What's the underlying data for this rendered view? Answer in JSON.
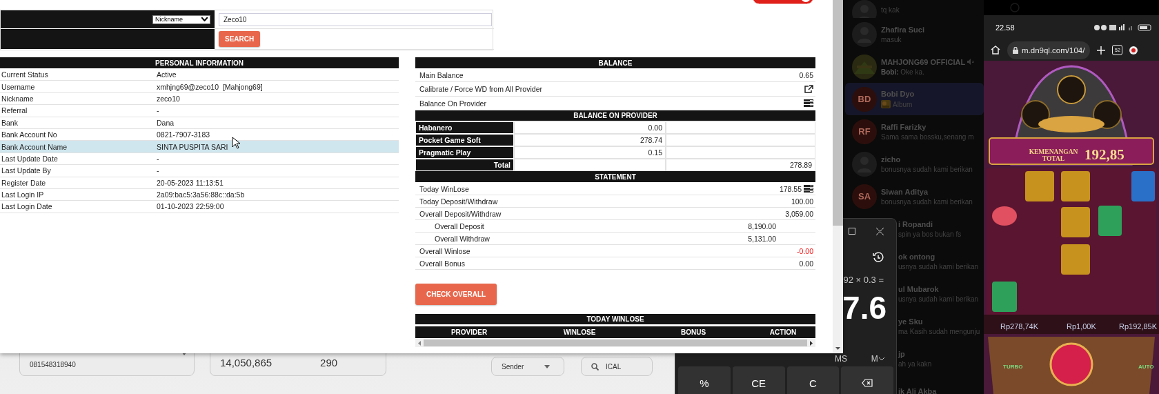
{
  "search": {
    "select_value": "Nickname",
    "value": "Zeco10",
    "button": "SEARCH"
  },
  "personal_information": {
    "title": "PERSONAL INFORMATION",
    "rows": [
      {
        "label": "Current Status",
        "value": "Active",
        "selected": false
      },
      {
        "label": "Username",
        "value": "xmhjng69@zeco10  [Mahjong69]",
        "selected": false
      },
      {
        "label": "Nickname",
        "value": "zeco10",
        "selected": false
      },
      {
        "label": "Referral",
        "value": "-",
        "selected": false
      },
      {
        "label": "Bank",
        "value": "Dana",
        "selected": false
      },
      {
        "label": "Bank Account No",
        "value": "0821-7907-3183",
        "selected": false
      },
      {
        "label": "Bank Account Name",
        "value": "SINTA PUSPITA SARI",
        "selected": true
      },
      {
        "label": "Last Update Date",
        "value": "-",
        "selected": false
      },
      {
        "label": "Last Update By",
        "value": "-",
        "selected": false
      },
      {
        "label": "Register Date",
        "value": "20-05-2023 11:13:51",
        "selected": false
      },
      {
        "label": "Last Login IP",
        "value": "2a09:bac5:3a56:88c::da:5b",
        "selected": false
      },
      {
        "label": "Last Login Date",
        "value": "01-10-2023 22:59:00",
        "selected": false
      }
    ]
  },
  "balance": {
    "title": "BALANCE",
    "rows": [
      {
        "kind": "value",
        "label": "Main Balance",
        "value": "0.65"
      },
      {
        "kind": "share",
        "label": "Calibrate / Force WD from All Provider"
      },
      {
        "kind": "list",
        "label": "Balance On Provider"
      }
    ]
  },
  "provider_balance": {
    "title": "BALANCE ON PROVIDER",
    "rows": [
      {
        "name": "Habanero",
        "amount": "0.00"
      },
      {
        "name": "Pocket Game Soft",
        "amount": "278.74"
      },
      {
        "name": "Pragmatic Play",
        "amount": "0.15"
      }
    ],
    "total": {
      "label": "Total",
      "amount": "278.89"
    }
  },
  "statement": {
    "title": "STATEMENT",
    "rows": [
      {
        "kind": "main_list",
        "label": "Today WinLose",
        "value": "178.55",
        "negative": false
      },
      {
        "kind": "main",
        "label": "Today Deposit/Withdraw",
        "value": "100.00",
        "negative": false
      },
      {
        "kind": "main",
        "label": "Overall Deposit/Withdraw",
        "value": "3,059.00",
        "negative": false
      },
      {
        "kind": "sub",
        "label": "Overall Deposit",
        "value": "8,190.00",
        "negative": false
      },
      {
        "kind": "sub",
        "label": "Overall Withdraw",
        "value": "5,131.00",
        "negative": false
      },
      {
        "kind": "main",
        "label": "Overall Winlose",
        "value": "-0.00",
        "negative": true
      },
      {
        "kind": "main",
        "label": "Overall Bonus",
        "value": "0.00",
        "negative": false
      }
    ]
  },
  "check_button": "CHECK OVERALL",
  "today_winlose": {
    "title": "TODAY WINLOSE",
    "columns": [
      "PROVIDER",
      "WINLOSE",
      "BONUS",
      "ACTION"
    ]
  },
  "background_page": {
    "phone_field": "081548318940",
    "stats": [
      "14,050,865",
      "290"
    ],
    "sender_select": "Sender",
    "search_value": "ICAL"
  },
  "calculator": {
    "expression": "92 × 0.3 =",
    "result": "7.6",
    "memory_keys": [
      {
        "kind": "text",
        "label": "MS"
      },
      {
        "kind": "menu",
        "label": "M"
      }
    ],
    "keys": [
      {
        "kind": "text",
        "label": "%"
      },
      {
        "kind": "text",
        "label": "CE"
      },
      {
        "kind": "text",
        "label": "C"
      },
      {
        "kind": "backspace"
      }
    ]
  },
  "chat": {
    "items": [
      {
        "preview": "tq kak",
        "selected": false,
        "media": false
      },
      {
        "name": "Zhafira Suci",
        "preview": "masuk",
        "selected": false,
        "muted": false,
        "media": false
      },
      {
        "kind": "logo",
        "name": "MAHJONG69 OFFICIAL",
        "preview": "**Bobi:** Oke ka.",
        "selected": false,
        "muted": true,
        "media": false
      },
      {
        "kind": "initials",
        "name": "Bobi Dyo",
        "preview": "Album",
        "initials": "BD",
        "selected": true,
        "muted": false,
        "media": true
      },
      {
        "kind": "initials",
        "name": "Raffi Farizky",
        "preview": "Sama sama bossku,senang m",
        "initials": "RF",
        "selected": false,
        "muted": false,
        "media": false
      },
      {
        "name": "zicho",
        "preview": "bonusnya sudah kami berikan",
        "selected": false,
        "muted": false,
        "media": false
      },
      {
        "kind": "initials",
        "name": "Siwan Aditya",
        "preview": "bonusnya sudah kami berikan",
        "initials": "SA",
        "selected": false,
        "muted": false,
        "media": false
      },
      {
        "kind": "covered",
        "name": "i Ropandi",
        "preview": "spin ya bos bukan fs",
        "selected": false,
        "muted": false,
        "media": false
      },
      {
        "kind": "covered",
        "name": "ok ontong",
        "preview": "usnya sudah kami berikan",
        "selected": false,
        "muted": false,
        "media": false
      },
      {
        "kind": "covered",
        "name": "ul Mubarok",
        "preview": "usnya sudah kami berikan",
        "selected": false,
        "muted": false,
        "media": false
      },
      {
        "kind": "covered",
        "name": "ye Sku",
        "preview": "ma Kasih sudah mengunju",
        "selected": false,
        "muted": false,
        "media": false
      },
      {
        "kind": "covered",
        "name": "jp",
        "preview": "ah ya kakn",
        "selected": false,
        "muted": false,
        "media": false
      },
      {
        "kind": "covered",
        "name": "ik Ali Akba",
        "selected": false,
        "muted": false
      }
    ]
  },
  "phone": {
    "time": "22.58",
    "url": "m.dn9ql.com/104/",
    "tab_count": "52",
    "game": {
      "kind": "picture",
      "win_label": "KEMENANGAN TOTAL",
      "win_amount": "192,85",
      "balances": [
        "Rp278,74K",
        "Rp1,00K",
        "Rp192,85K"
      ],
      "buttons": [
        "TURBO",
        "AUTO"
      ]
    }
  }
}
